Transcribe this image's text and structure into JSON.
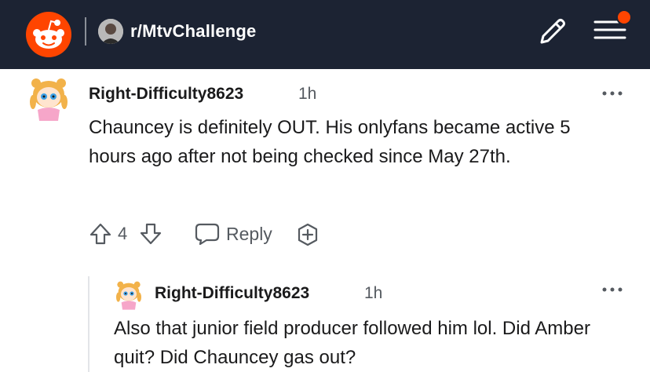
{
  "header": {
    "subreddit": "r/MtvChallenge",
    "icons": [
      "reddit-logo",
      "subreddit-avatar",
      "pencil-icon",
      "menu-icon"
    ],
    "colors": {
      "bar": "#1c2333",
      "brand": "#ff4500"
    }
  },
  "comments": [
    {
      "username": "Right-Difficulty8623",
      "time": "1h",
      "body": "Chauncey is definitely OUT. His onlyfans became active 5 hours ago after not being checked since May 27th.",
      "votes": "4",
      "reply_label": "Reply"
    },
    {
      "username": "Right-Difficulty8623",
      "time": "1h",
      "body": "Also that junior field producer followed him lol. Did Amber quit? Did Chauncey gas out?"
    }
  ]
}
